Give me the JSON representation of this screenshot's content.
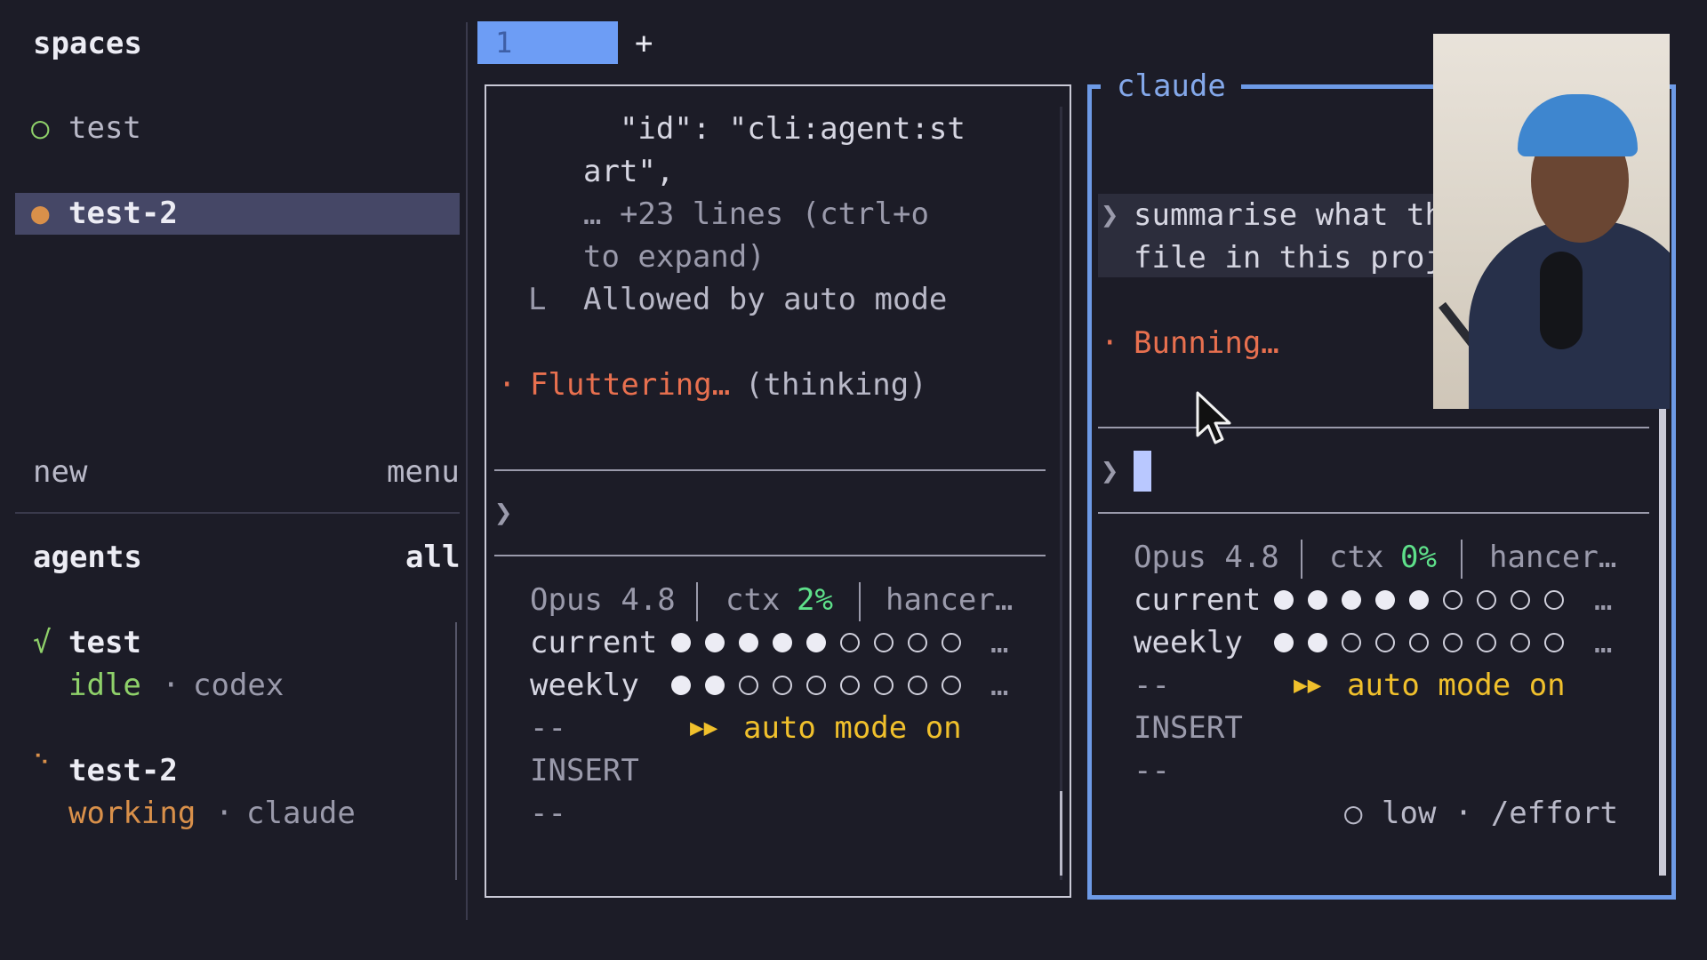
{
  "sidebar": {
    "spaces_title": "spaces",
    "spaces": [
      {
        "label": "test",
        "status_icon": "○"
      },
      {
        "label": "test-2",
        "status_icon": "●"
      }
    ],
    "new_label": "new",
    "menu_label": "menu",
    "agents_title": "agents",
    "agents_filter": "all",
    "agents": [
      {
        "icon": "√",
        "name": "test",
        "state": "idle",
        "sep": "·",
        "type": "codex"
      },
      {
        "icon": "⠑",
        "name": "test-2",
        "state": "working",
        "sep": "·",
        "type": "claude"
      }
    ]
  },
  "tabs": {
    "active": "1",
    "add": "+"
  },
  "left_pane": {
    "lines": [
      "  \"id\": \"cli:agent:st",
      "art\",",
      "… +23 lines (ctrl+o",
      "to expand)"
    ],
    "tree_char": "L",
    "allowed": "Allowed by auto mode",
    "bullet": "·",
    "activity": "Fluttering…",
    "activity_note": "(thinking)",
    "prompt_char": "❯",
    "model": "Opus 4.8",
    "ctx_label": "ctx",
    "ctx_value": "2%",
    "extra": "hancer…",
    "current_label": "current",
    "current_filled": 5,
    "weekly_label": "weekly",
    "weekly_filled": 2,
    "ellipsis": "…",
    "dashes": "--",
    "auto_arrows": "▶▶",
    "auto_mode": "auto mode on",
    "mode": "INSERT",
    "dashes2": "--"
  },
  "right_pane": {
    "title": "claude",
    "prompt_char": "❯",
    "prompt_lines": [
      "summarise what th",
      "file in this proj"
    ],
    "bullet": "·",
    "activity": "Bunning…",
    "input_prompt": "❯",
    "model": "Opus 4.8",
    "ctx_label": "ctx",
    "ctx_value": "0%",
    "extra": "hancer…",
    "current_label": "current",
    "current_filled": 5,
    "weekly_label": "weekly",
    "weekly_filled": 2,
    "ellipsis": "…",
    "dashes": "--",
    "auto_arrows": "▶▶",
    "auto_mode": "auto mode on",
    "mode": "INSERT",
    "dashes2": "--",
    "effort_icon": "○",
    "effort": "low · /effort"
  },
  "colors": {
    "background": "#1c1c27",
    "accent_blue": "#6d9df5",
    "selected_row": "#454766",
    "activity_red": "#e8704f",
    "auto_yellow": "#f0c02c",
    "ctx_green": "#5ee08a"
  }
}
